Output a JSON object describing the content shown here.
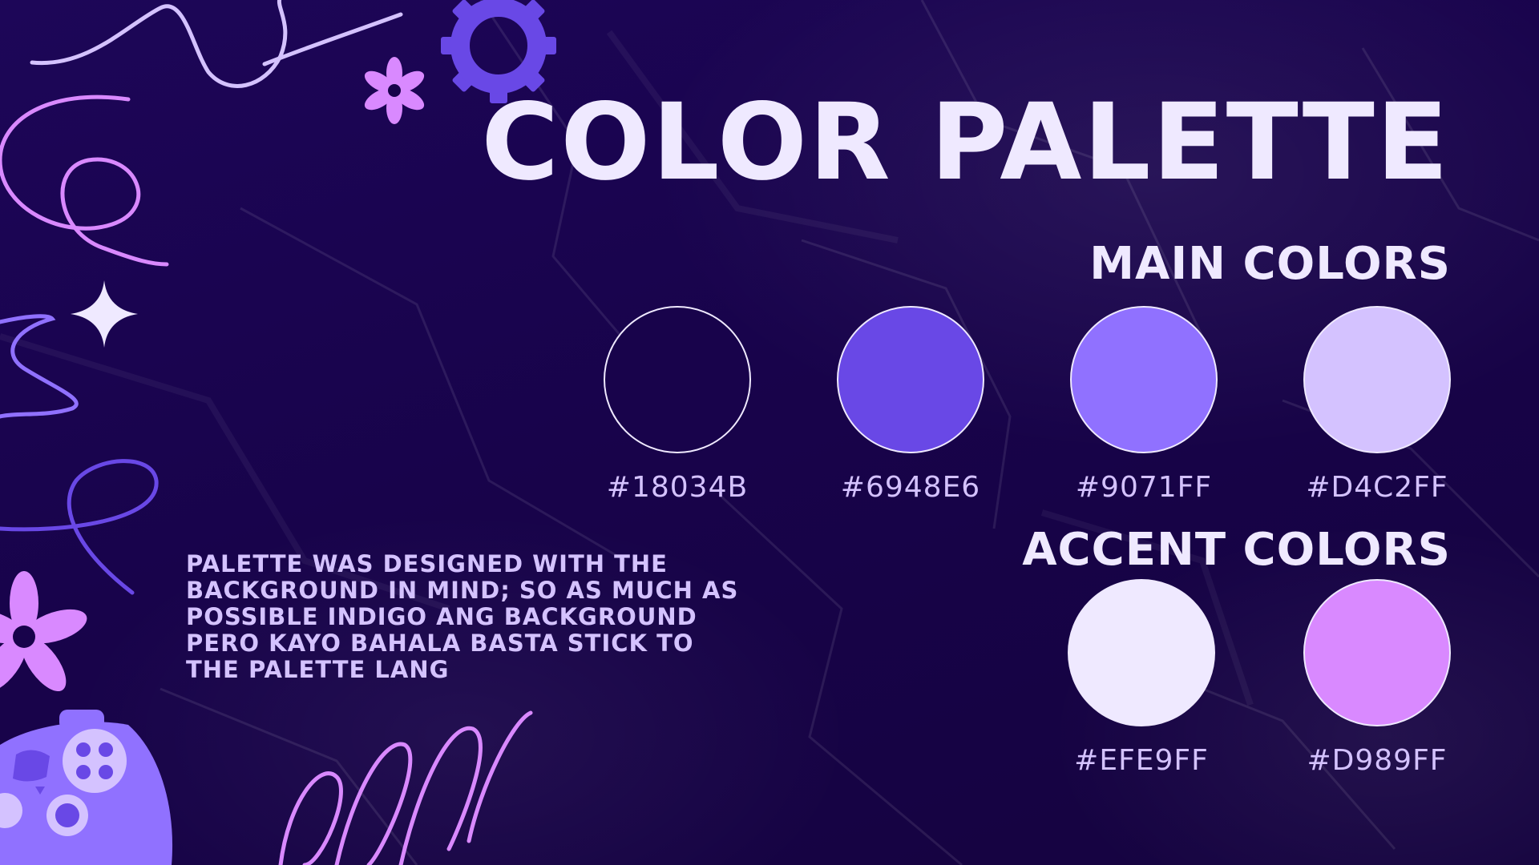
{
  "slide": {
    "title": "COLOR PALETTE",
    "note": "PALETTE WAS DESIGNED WITH THE BACKGROUND IN MIND; SO AS MUCH AS POSSIBLE INDIGO ANG BACKGROUND PERO KAYO BAHALA BASTA STICK TO THE PALETTE LANG",
    "background_color": "#18034B"
  },
  "main_colors": {
    "heading": "MAIN COLORS",
    "swatches": [
      {
        "hex": "#18034B",
        "color": "#18034B"
      },
      {
        "hex": "#6948E6",
        "color": "#6948E6"
      },
      {
        "hex": "#9071FF",
        "color": "#9071FF"
      },
      {
        "hex": "#D4C2FF",
        "color": "#D4C2FF"
      }
    ]
  },
  "accent_colors": {
    "heading": "ACCENT COLORS",
    "swatches": [
      {
        "hex": "#EFE9FF",
        "color": "#EFE9FF"
      },
      {
        "hex": "#D989FF",
        "color": "#D989FF"
      }
    ]
  },
  "decorations": {
    "icons": [
      "squiggle-line-icon",
      "gear-icon",
      "flower-icon",
      "sparkle-icon",
      "game-controller-icon",
      "spiral-scribble-icon"
    ]
  }
}
